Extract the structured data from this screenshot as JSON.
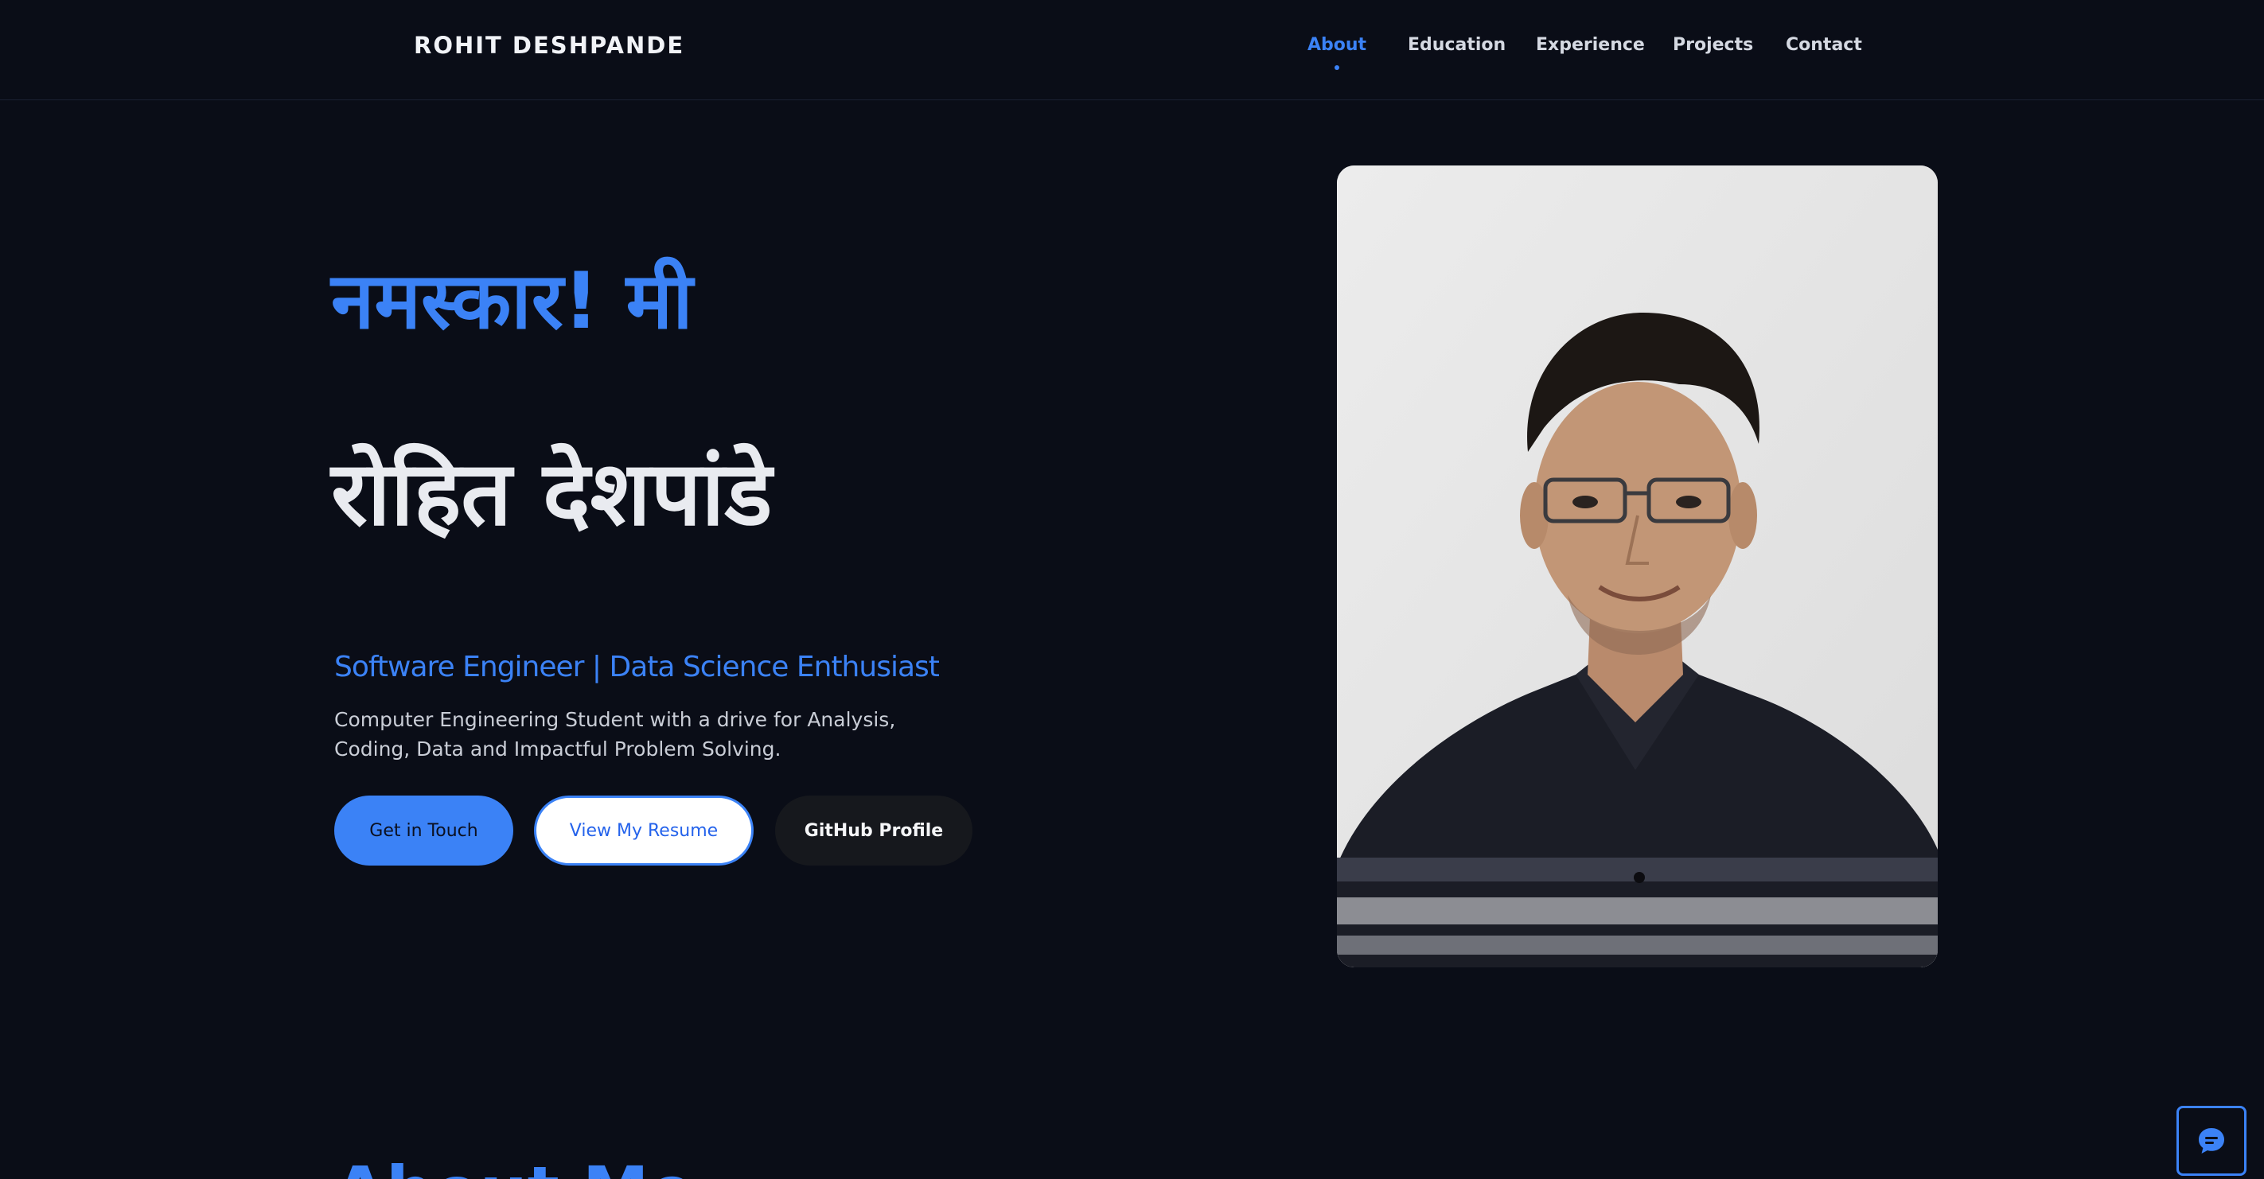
{
  "header": {
    "brand": "ROHIT DESHPANDE",
    "nav": [
      {
        "label": "About",
        "active": true
      },
      {
        "label": "Education",
        "active": false
      },
      {
        "label": "Experience",
        "active": false
      },
      {
        "label": "Projects",
        "active": false
      },
      {
        "label": "Contact",
        "active": false
      }
    ]
  },
  "hero": {
    "greeting": "नमस्कार! मी",
    "name": "रोहित देशपांडे",
    "role": "Software Engineer | Data Science Enthusiast",
    "description": "Computer Engineering Student with a drive for Analysis, Coding, Data and Impactful Problem Solving.",
    "buttons": {
      "get_in_touch": "Get in Touch",
      "view_resume": "View My Resume",
      "github": "GitHub Profile"
    }
  },
  "about": {
    "heading": "About Me"
  },
  "chat": {
    "icon": "chat-bubble-icon"
  },
  "colors": {
    "background": "#0a0d17",
    "accent": "#3b82f6",
    "text": "#e6e8ee"
  }
}
